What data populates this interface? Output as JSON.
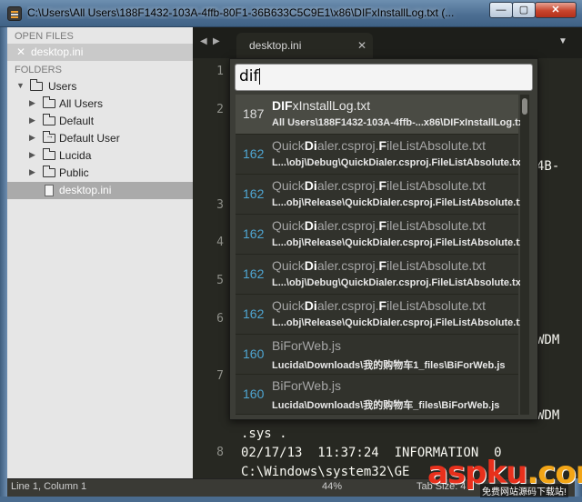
{
  "window": {
    "title": "C:\\Users\\All Users\\188F1432-103A-4ffb-80F1-36B633C5C9E1\\x86\\DIFxInstallLog.txt (...",
    "min_glyph": "—",
    "max_glyph": "▢",
    "close_glyph": "✕"
  },
  "sidebar": {
    "open_files_header": "OPEN FILES",
    "open_file": "desktop.ini",
    "close_glyph": "✕",
    "folders_header": "FOLDERS",
    "tree": [
      {
        "label": "Users",
        "kind": "folder",
        "expanded": true
      },
      {
        "label": "All Users",
        "kind": "folder"
      },
      {
        "label": "Default",
        "kind": "folder"
      },
      {
        "label": "Default User",
        "kind": "folder-link"
      },
      {
        "label": "Lucida",
        "kind": "folder"
      },
      {
        "label": "Public",
        "kind": "folder"
      },
      {
        "label": "desktop.ini",
        "kind": "file",
        "selected": true
      }
    ]
  },
  "tabs": {
    "back_glyph": "◀",
    "forward_glyph": "▶",
    "active_tab": "desktop.ini",
    "close_glyph": "✕",
    "menu_glyph": "▼"
  },
  "editor": {
    "line_numbers": [
      "1",
      "2",
      "3",
      "4",
      "5",
      "6",
      "7",
      "8"
    ],
    "visible_fragments": {
      "l2_tail": "4B-",
      "l6_tail": "WDM",
      "l7_tail": "WDM",
      "sys_line": ".sys .",
      "line8": "02/17/13  11:37:24  INFORMATION  0",
      "line9": "C:\\Windows\\system32\\GE"
    }
  },
  "goto": {
    "query": "dif",
    "results": [
      {
        "score": "187",
        "title": "DIFxInstallLog.txt",
        "path": "All Users\\188F1432-103A-4ffb-...x86\\DIFxInstallLog.tx",
        "selected": true
      },
      {
        "score": "162",
        "title": "QuickDialer.csproj.FileListAbsolute.txt",
        "path": "L...\\obj\\Debug\\QuickDialer.csproj.FileListAbsolute.txt"
      },
      {
        "score": "162",
        "title": "QuickDialer.csproj.FileListAbsolute.txt",
        "path": "L...obj\\Release\\QuickDialer.csproj.FileListAbsolute.txt"
      },
      {
        "score": "162",
        "title": "QuickDialer.csproj.FileListAbsolute.txt",
        "path": "L...obj\\Release\\QuickDialer.csproj.FileListAbsolute.txt"
      },
      {
        "score": "162",
        "title": "QuickDialer.csproj.FileListAbsolute.txt",
        "path": "L...\\obj\\Debug\\QuickDialer.csproj.FileListAbsolute.txt"
      },
      {
        "score": "162",
        "title": "QuickDialer.csproj.FileListAbsolute.txt",
        "path": "L...obj\\Release\\QuickDialer.csproj.FileListAbsolute.txt"
      },
      {
        "score": "160",
        "title": "BiForWeb.js",
        "path": "Lucida\\Downloads\\我的购物车1_files\\BiForWeb.js"
      },
      {
        "score": "160",
        "title": "BiForWeb.js",
        "path": "Lucida\\Downloads\\我的购物车_files\\BiForWeb.js"
      }
    ]
  },
  "status": {
    "position": "Line 1, Column 1",
    "zoom": "44%",
    "tab_size": "Tab Size: 4"
  },
  "watermark": {
    "brand": "aspku",
    "tld": ".com",
    "sub": "免费网站源码下载站!"
  },
  "colors": {
    "editor_bg": "#272822",
    "score_accent": "#4fa6d3",
    "sidebar_bg": "#e6e6e6"
  }
}
